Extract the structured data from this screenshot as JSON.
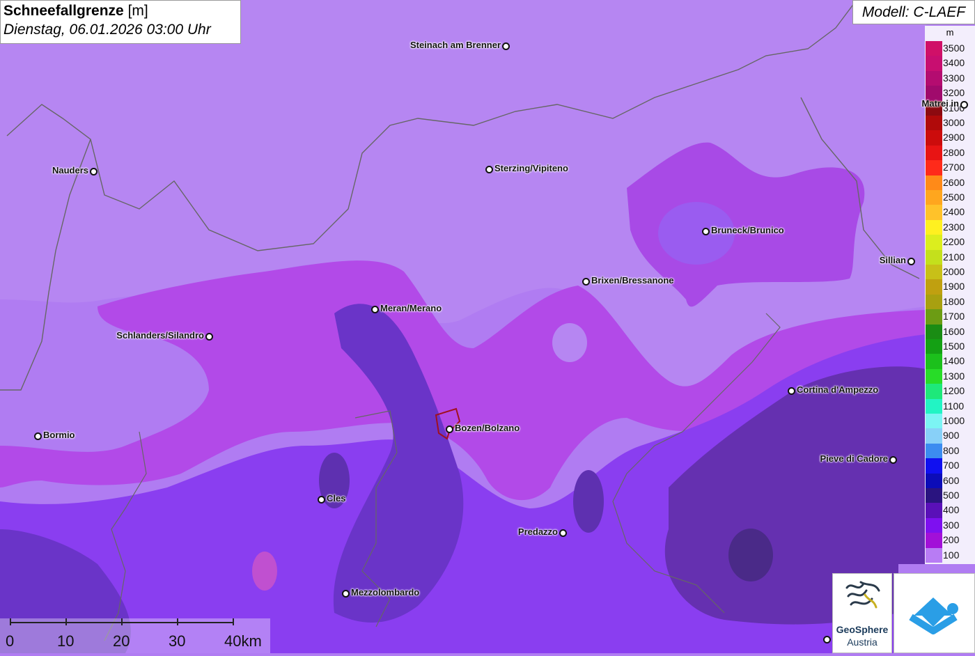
{
  "title": {
    "main": "Schneefallgrenze",
    "unit": " [m]",
    "subtitle": "Dienstag, 06.01.2026 03:00 Uhr"
  },
  "model": "Modell: C-LAEF",
  "legend": {
    "unit": "m",
    "items": [
      {
        "label": "3500",
        "color": "#d01068"
      },
      {
        "label": "3400",
        "color": "#c80e70"
      },
      {
        "label": "3300",
        "color": "#b40c70"
      },
      {
        "label": "3200",
        "color": "#a00a6c"
      },
      {
        "label": "3100",
        "color": "#8c0a10"
      },
      {
        "label": "3000",
        "color": "#b00a0a"
      },
      {
        "label": "2900",
        "color": "#cc0c0c"
      },
      {
        "label": "2800",
        "color": "#e81414"
      },
      {
        "label": "2700",
        "color": "#ff2a1a"
      },
      {
        "label": "2600",
        "color": "#ff8a18"
      },
      {
        "label": "2500",
        "color": "#ffa61e"
      },
      {
        "label": "2400",
        "color": "#ffc22a"
      },
      {
        "label": "2300",
        "color": "#fff020"
      },
      {
        "label": "2200",
        "color": "#dcee1e"
      },
      {
        "label": "2100",
        "color": "#c4e01c"
      },
      {
        "label": "2000",
        "color": "#c8c018"
      },
      {
        "label": "1900",
        "color": "#c0a010"
      },
      {
        "label": "1800",
        "color": "#a8a010"
      },
      {
        "label": "1700",
        "color": "#6c9c14"
      },
      {
        "label": "1600",
        "color": "#1a8c14"
      },
      {
        "label": "1500",
        "color": "#14a014"
      },
      {
        "label": "1400",
        "color": "#1cc01c"
      },
      {
        "label": "1300",
        "color": "#28dc28"
      },
      {
        "label": "1200",
        "color": "#1ee87a"
      },
      {
        "label": "1100",
        "color": "#22f4c4"
      },
      {
        "label": "1000",
        "color": "#7cf4f4"
      },
      {
        "label": "900",
        "color": "#88d0f8"
      },
      {
        "label": "800",
        "color": "#3c8cf0"
      },
      {
        "label": "700",
        "color": "#1010f0"
      },
      {
        "label": "600",
        "color": "#0c0cb8"
      },
      {
        "label": "500",
        "color": "#2a1480"
      },
      {
        "label": "400",
        "color": "#5a10b8"
      },
      {
        "label": "300",
        "color": "#7e10f0"
      },
      {
        "label": "200",
        "color": "#a210d8"
      },
      {
        "label": "100",
        "color": "#b87cf4"
      }
    ]
  },
  "cities": [
    {
      "name": "Steinach am Brenner",
      "side": "left"
    },
    {
      "name": "Matrei in",
      "side": "left"
    },
    {
      "name": "Nauders",
      "side": "left"
    },
    {
      "name": "Sterzing/Vipiteno",
      "side": "right"
    },
    {
      "name": "Bruneck/Brunico",
      "side": "right"
    },
    {
      "name": "Sillian",
      "side": "left"
    },
    {
      "name": "Brixen/Bressanone",
      "side": "right"
    },
    {
      "name": "Meran/Merano",
      "side": "right"
    },
    {
      "name": "Schlanders/Silandro",
      "side": "left"
    },
    {
      "name": "Cortina d'Ampezzo",
      "side": "right"
    },
    {
      "name": "Bozen/Bolzano",
      "side": "right"
    },
    {
      "name": "Bormio",
      "side": "right"
    },
    {
      "name": "Pieve di Cadore",
      "side": "left"
    },
    {
      "name": "Cles",
      "side": "right"
    },
    {
      "name": "Predazzo",
      "side": "left"
    },
    {
      "name": "Mezzolombardo",
      "side": "right"
    },
    {
      "name": "",
      "side": "right"
    }
  ],
  "scale": {
    "labels": [
      "0",
      "10",
      "20",
      "30",
      "40km"
    ]
  },
  "logos": {
    "geosphere_line1": "GeoSphere",
    "geosphere_line2": "Austria"
  }
}
